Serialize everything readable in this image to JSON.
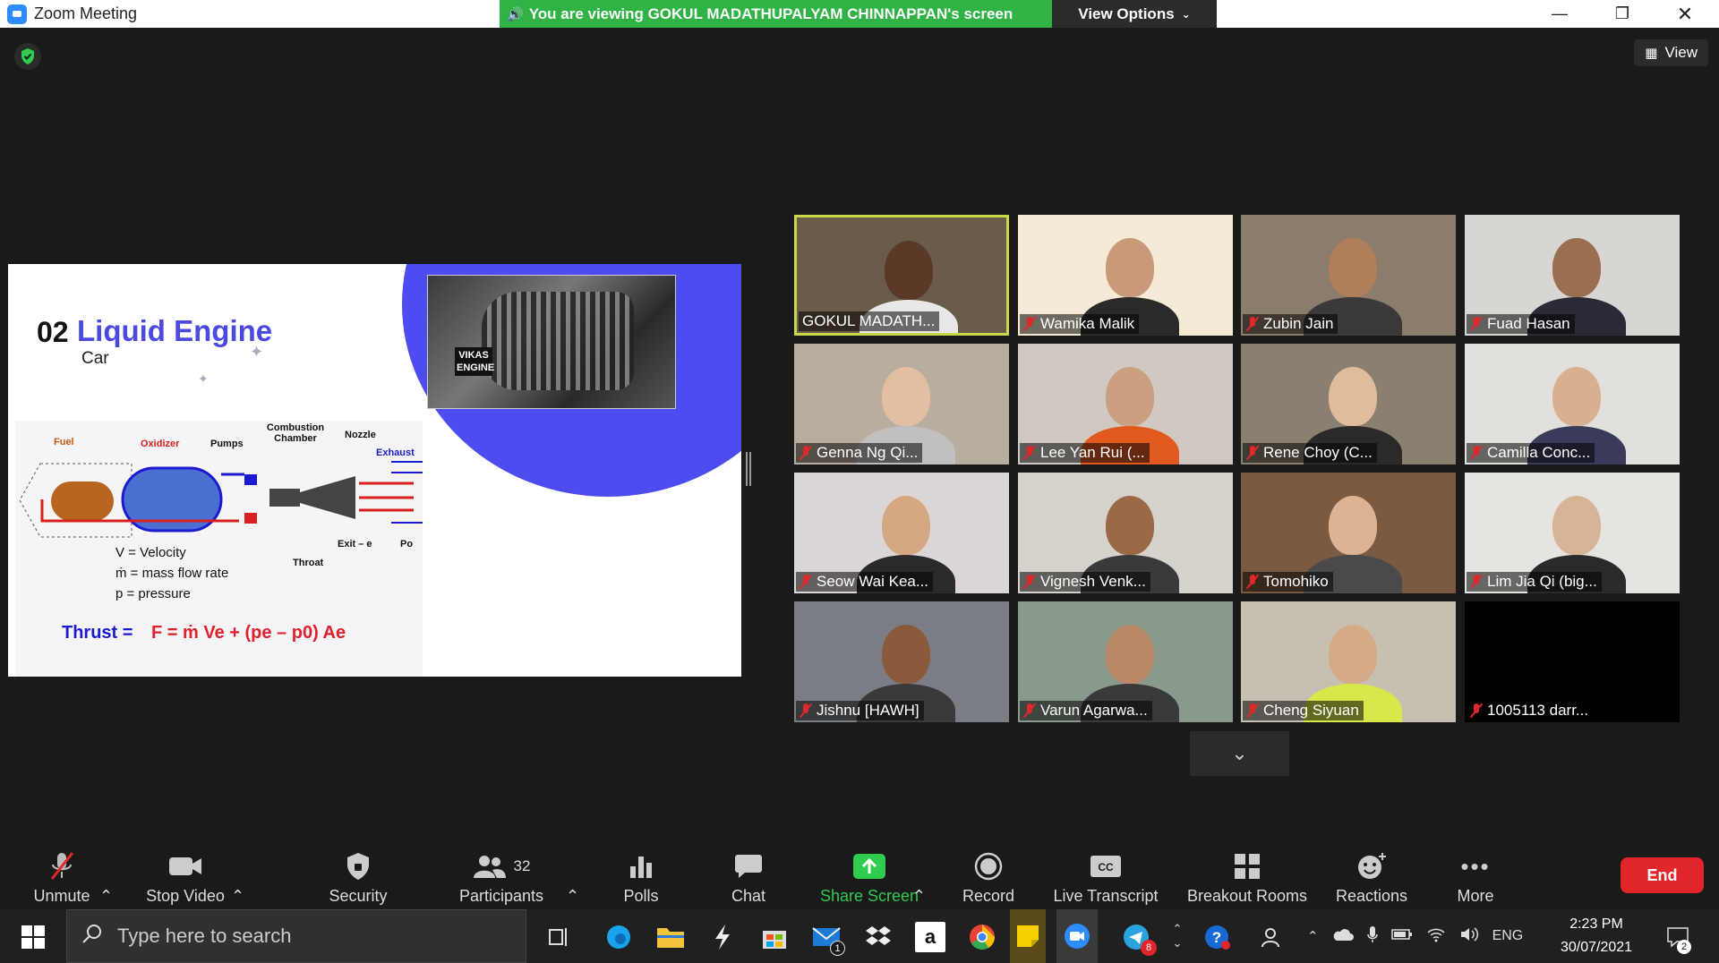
{
  "window": {
    "title": "Zoom Meeting",
    "banner": "You are viewing GOKUL MADATHUPALYAM CHINNAPPAN's screen",
    "view_options": "View Options",
    "view_label": "View"
  },
  "slide": {
    "number": "02",
    "heading": "Liquid Engine",
    "subheading": "Car",
    "photo_label": "VIKAS ENGINE",
    "diagram_labels": {
      "fuel": "Fuel",
      "oxidizer": "Oxidizer",
      "pumps": "Pumps",
      "combustion": "Combustion Chamber",
      "nozzle": "Nozzle",
      "exhaust": "Exhaust",
      "throat": "Throat",
      "exit": "Exit – e",
      "p0": "Po"
    },
    "legend": [
      "V =  Velocity",
      "ṁ =  mass  flow  rate",
      "p =  pressure"
    ],
    "thrust_label": "Thrust =",
    "formula": "F = ṁ Ve + (pe – p0) Ae"
  },
  "participants": [
    {
      "name": "GOKUL MADATH...",
      "muted": false,
      "active": true,
      "bg": "#6b5c4a",
      "skin": "#5a3a26",
      "shirt": "#e8e8e8"
    },
    {
      "name": "Wamika Malik",
      "muted": true,
      "active": false,
      "bg": "#f4ead5",
      "skin": "#c89a7a",
      "shirt": "#2a2a2a"
    },
    {
      "name": "Zubin Jain",
      "muted": true,
      "active": false,
      "bg": "#8a7d6c",
      "skin": "#b07e5a",
      "shirt": "#3a3a3a"
    },
    {
      "name": "Fuad Hasan",
      "muted": true,
      "active": false,
      "bg": "#d8d6d2",
      "skin": "#9a6e50",
      "shirt": "#2a2a36"
    },
    {
      "name": "Genna Ng Qi...",
      "muted": true,
      "active": false,
      "bg": "#b8aea0",
      "skin": "#e2bfa0",
      "shirt": "#c0c0c0"
    },
    {
      "name": "Lee Yan Rui (...",
      "muted": true,
      "active": false,
      "bg": "#cfc9c2",
      "skin": "#caa080",
      "shirt": "#e05a20"
    },
    {
      "name": "Rene Choy (C...",
      "muted": true,
      "active": false,
      "bg": "#8a8070",
      "skin": "#e0bc9c",
      "shirt": "#2a2a2a"
    },
    {
      "name": "Camilla Conc...",
      "muted": true,
      "active": false,
      "bg": "#e2e0dc",
      "skin": "#d8b090",
      "shirt": "#3a3a5a"
    },
    {
      "name": "Seow Wai Kea...",
      "muted": true,
      "active": false,
      "bg": "#ddd6d6",
      "skin": "#d4a882",
      "shirt": "#2a2a2a"
    },
    {
      "name": "Vignesh Venk...",
      "muted": true,
      "active": false,
      "bg": "#d6d2cc",
      "skin": "#9a6a48",
      "shirt": "#3a3a3a"
    },
    {
      "name": "Tomohiko",
      "muted": true,
      "active": false,
      "bg": "#7a5a40",
      "skin": "#dcb494",
      "shirt": "#4a4a4a"
    },
    {
      "name": "Lim Jia Qi (big...",
      "muted": true,
      "active": false,
      "bg": "#e6e4e0",
      "skin": "#d8b496",
      "shirt": "#2a2a2a"
    },
    {
      "name": "Jishnu [HAWH]",
      "muted": true,
      "active": false,
      "bg": "#7a7e84",
      "skin": "#8a5a3c",
      "shirt": "#3a3a3a"
    },
    {
      "name": "Varun Agarwa...",
      "muted": true,
      "active": false,
      "bg": "#8a9a8a",
      "skin": "#b88a6a",
      "shirt": "#3a3a3a"
    },
    {
      "name": "Cheng Siyuan",
      "muted": true,
      "active": false,
      "bg": "#c6c0b2",
      "skin": "#d4aa88",
      "shirt": "#d8e84a"
    },
    {
      "name": "1005113 darr...",
      "muted": true,
      "active": false,
      "bg": "#000000",
      "skin": "",
      "shirt": ""
    }
  ],
  "toolbar": {
    "unmute": "Unmute",
    "stop_video": "Stop Video",
    "security": "Security",
    "participants": "Participants",
    "participants_count": "32",
    "polls": "Polls",
    "chat": "Chat",
    "share_screen": "Share Screen",
    "record": "Record",
    "live_transcript": "Live Transcript",
    "breakout_rooms": "Breakout Rooms",
    "reactions": "Reactions",
    "more": "More",
    "end": "End"
  },
  "taskbar": {
    "search_placeholder": "Type here to search",
    "language": "ENG",
    "time": "2:23 PM",
    "date": "30/07/2021",
    "notifications": "2",
    "mail_badge": "1",
    "telegram_badge": "8"
  },
  "colors": {
    "banner_green": "#2fb344",
    "end_red": "#e0262a",
    "slide_accent": "#4c4cf0",
    "active_border": "#c7d94a"
  }
}
